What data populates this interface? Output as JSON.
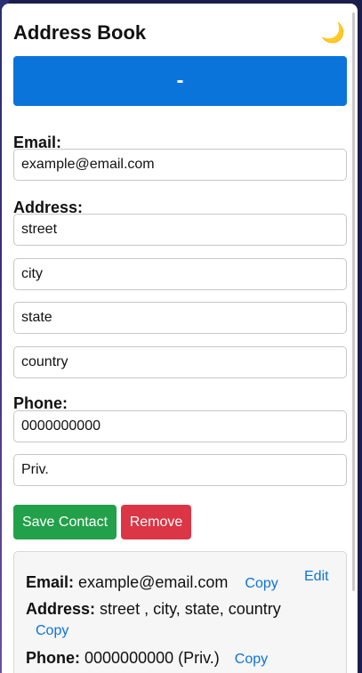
{
  "app": {
    "title": "Address Book",
    "theme_icon": "moon-icon",
    "theme_glyph": "🌙"
  },
  "toolbar": {
    "toggle_label": "-"
  },
  "form": {
    "email_label": "Email:",
    "email_value": "example@email.com",
    "address_label": "Address:",
    "street_value": "street",
    "city_value": "city",
    "state_value": "state",
    "country_value": "country",
    "phone_label": "Phone:",
    "phone_value": "0000000000",
    "phone_type_value": "Priv."
  },
  "actions": {
    "save_label": "Save Contact",
    "remove_label": "Remove"
  },
  "contact_card": {
    "email_label": "Email:",
    "email_value": "example@email.com",
    "address_label": "Address:",
    "address_value": "street , city, state, country",
    "phone_label": "Phone:",
    "phone_value": "0000000000 (Priv.)",
    "copy_label": "Copy",
    "edit_label": "Edit"
  },
  "colors": {
    "primary": "#0a74da",
    "success": "#22a04a",
    "danger": "#dc3545"
  }
}
